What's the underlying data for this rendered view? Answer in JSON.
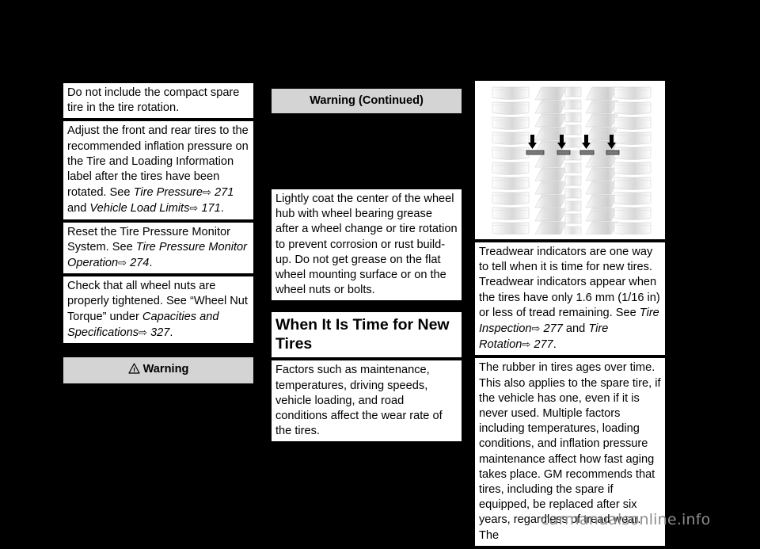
{
  "page": {
    "background_color": "#000000",
    "text_block_color": "#ffffff",
    "banner_color": "#d4d4d4",
    "watermark": "carmanualsonline.info",
    "watermark_color": "#8c8c8c"
  },
  "left_column": {
    "blocks": [
      {
        "id": "compact-spare-note",
        "text": "Do not include the compact spare tire in the tire rotation."
      },
      {
        "id": "inflation-pressure-note",
        "text_part1": "Adjust the front and rear tires to the recommended inflation pressure on the Tire and Loading Information label after the tires have been rotated. See ",
        "ref1_label": "Tire Pressure",
        "ref1_arrow": "⇨",
        "ref1_page": "271",
        "conjunction": " and ",
        "ref2_label": "Vehicle Load Limits",
        "ref2_arrow": "⇨",
        "ref2_page": "171",
        "period": "."
      },
      {
        "id": "tpms-reset-note",
        "text_part1": "Reset the Tire Pressure Monitor System. See ",
        "ref1_label": "Tire Pressure Monitor Operation",
        "ref1_arrow": "⇨",
        "ref1_page": "274",
        "period": "."
      },
      {
        "id": "wheel-nut-note",
        "text_part1": "Check that all wheel nuts are properly tightened. See “Wheel Nut Torque” under ",
        "ref1_label": "Capacities and Specifications",
        "ref1_arrow": "⇨",
        "ref1_page": "327",
        "period": "."
      }
    ],
    "warning_banner": {
      "icon": "warning-triangle-icon",
      "label": "Warning"
    }
  },
  "middle_column": {
    "warning_continued_banner": {
      "label": "Warning  (Continued)"
    },
    "grease_note": {
      "text": "Lightly coat the center of the wheel hub with wheel bearing grease after a wheel change or tire rotation to prevent corrosion or rust build-up. Do not get grease on the flat wheel mounting surface or on the wheel nuts or bolts."
    },
    "section_heading": "When It Is Time for New Tires",
    "factors_note": {
      "text": "Factors such as maintenance, temperatures, driving speeds, vehicle loading, and road conditions affect the wear rate of the tires."
    }
  },
  "right_column": {
    "figure": {
      "id": "tire-tread-figure",
      "alt": "Tire tread pattern with four arrows pointing at treadwear indicator bars",
      "arrow_count": 4
    },
    "treadwear_note": {
      "text_part1": "Treadwear indicators are one way to tell when it is time for new tires. Treadwear indicators appear when the tires have only 1.6 mm (1/16 in) or less of tread remaining. See ",
      "ref1_label": "Tire Inspection",
      "ref1_arrow": "⇨",
      "ref1_page": "277",
      "conjunction": " and ",
      "ref2_label": "Tire Rotation",
      "ref2_arrow": "⇨",
      "ref2_page": "277",
      "period": "."
    },
    "aging_note": {
      "text": "The rubber in tires ages over time. This also applies to the spare tire, if the vehicle has one, even if it is never used. Multiple factors including temperatures, loading conditions, and inflation pressure maintenance affect how fast aging takes place. GM recommends that tires, including the spare if equipped, be replaced after six years, regardless of tread wear. The"
    }
  }
}
